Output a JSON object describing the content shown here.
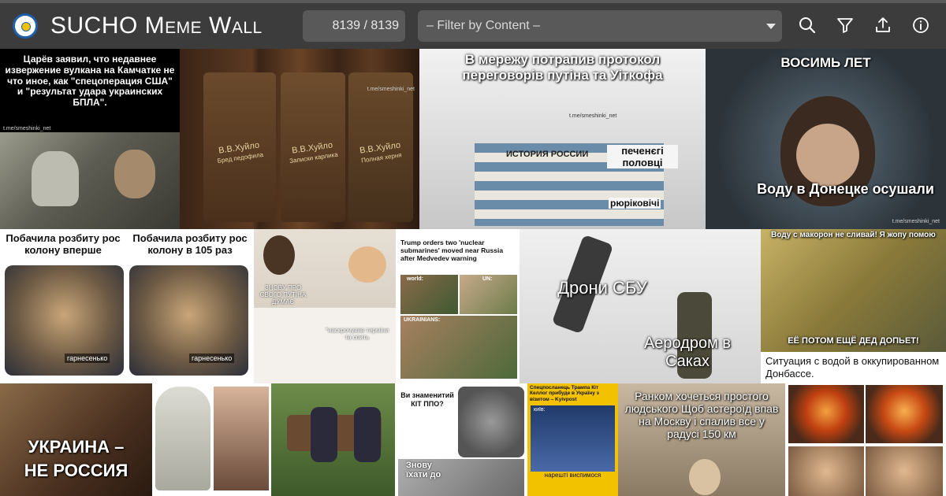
{
  "app": {
    "title": "SUCHO Meme Wall",
    "counter": "8139 / 8139",
    "filter_placeholder": "– Filter by Content –"
  },
  "toolbar": {
    "search_icon": "search-icon",
    "filter_icon": "filter-icon",
    "share_icon": "share-icon",
    "info_icon": "info-icon"
  },
  "memes": {
    "m1": {
      "caption": "Царёв заявил, что недавнее извержение вулкана на Камчатке не что иное, как \"спецоперация США\" и \"результат удара украинских БПЛА\".",
      "watermark": "t.me/smeshinki_net"
    },
    "m2": {
      "book1": "В.В.Хуйло",
      "book1_sub": "Бред педофила",
      "book2": "В.В.Хуйло",
      "book2_sub": "Записки карлика",
      "book3": "В.В.Хуйло",
      "book3_sub": "Полная херня",
      "watermark": "t.me/smeshinki_net"
    },
    "m3": {
      "caption": "В мережу потрапив протокол переговорів путіна та Уіткофа",
      "book": "ИСТОРИЯ РОССИИ",
      "note1": "печенєгі половці",
      "note2": "рюріковічі",
      "watermark": "t.me/smeshinki_net"
    },
    "m4": {
      "top": "ВОСИМЬ ЛЕТ",
      "bottom": "Воду в Донецке осушали",
      "watermark": "t.me/smeshinki_net"
    },
    "m5": {
      "left": "Побачила розбиту рос колону вперше",
      "right": "Побачила розбиту рос колону в 105 раз",
      "sub": "гарнесенько"
    },
    "m6": {
      "left": "ЗНОВУ ПРО СВОГО ПУТІНА ДУМАЄ",
      "right": "*наскрочував терміни та спить"
    },
    "m7": {
      "headline": "Trump orders two 'nuclear submarines' moved near Russia after Medvedev warning",
      "l1": "world:",
      "l2": "UN:",
      "l3": "UKRAINIANS:"
    },
    "m8": {
      "top": "Дрони СБУ",
      "bottom": "Аеродром в Саках"
    },
    "m9": {
      "top": "Воду с макорон не сливай! Я жопу помою",
      "bottom": "ЕЁ ПОТОМ ЕЩЁ ДЕД ДОПЬЕТ!",
      "caption": "Ситуация с водой в оккупированном Донбассе."
    },
    "m10": {
      "line1": "УКРАИНА –",
      "line2": "НЕ РОССИЯ"
    },
    "m13": {
      "top": "Ви знаменитий КІТ ППО?",
      "bottom": "Знову їхати до"
    },
    "m14": {
      "headline": "Спецпосланець Трампа Кіт Келлог прибуде в Україну з візитом – Kyivpost",
      "label": "київ:",
      "sub": "нарешті виспимося"
    },
    "m15": {
      "caption": "Ранком хочеться простого людського Щоб астероїд впав на Москву і спалив все у радусі 150 км"
    }
  },
  "colors": {
    "header_bg": "#3c3c3c",
    "control_bg": "#595959",
    "accent_blue": "#1f5fa8",
    "accent_yellow": "#f2c200"
  }
}
